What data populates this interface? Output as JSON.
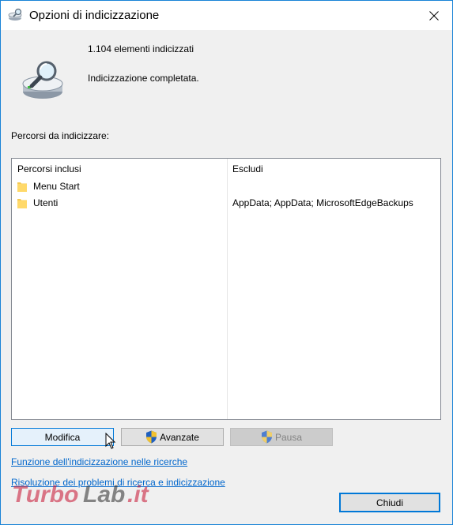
{
  "window": {
    "title": "Opzioni di indicizzazione"
  },
  "status": {
    "count_text": "1.104 elementi indicizzati",
    "state_text": "Indicizzazione completata."
  },
  "paths_label": "Percorsi da indicizzare:",
  "list": {
    "columns": [
      "Percorsi inclusi",
      "Escludi"
    ],
    "rows": [
      {
        "name": "Menu Start",
        "exclude": ""
      },
      {
        "name": "Utenti",
        "exclude": "AppData; AppData; MicrosoftEdgeBackups"
      }
    ]
  },
  "buttons": {
    "modify": "Modifica",
    "advanced": "Avanzate",
    "pause": "Pausa",
    "close": "Chiudi"
  },
  "links": {
    "search_indexing": "Funzione dell'indicizzazione nelle ricerche",
    "troubleshoot": "Risoluzione dei problemi di ricerca e indicizzazione"
  },
  "watermark": "TurboLab.it",
  "colors": {
    "accent": "#0078d7",
    "link": "#0066cc",
    "border": "#1883d7"
  },
  "icons": [
    "indexing-options-icon",
    "close-icon",
    "drive-search-icon",
    "folder-icon",
    "uac-shield-icon",
    "mouse-cursor-icon"
  ]
}
